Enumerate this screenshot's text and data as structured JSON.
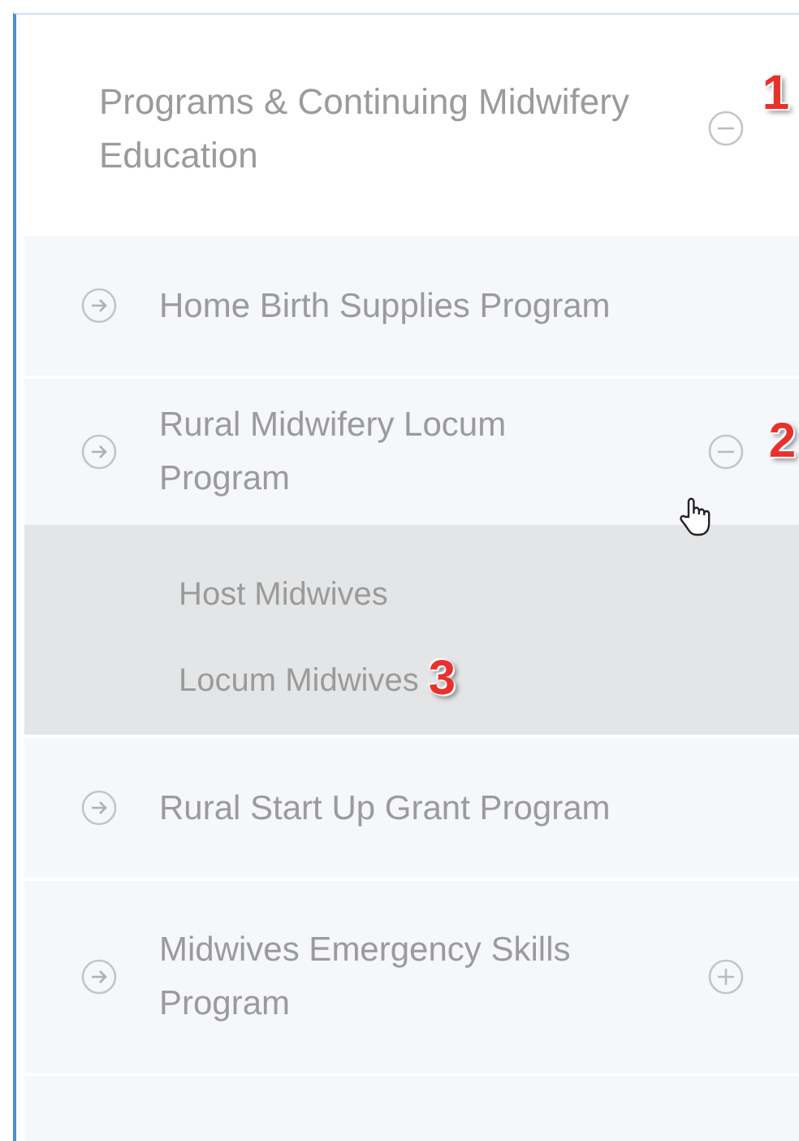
{
  "menu": {
    "header": {
      "label": "Programs & Continuing Midwifery Education",
      "expanded": true,
      "callout": "1"
    },
    "items": [
      {
        "label": "Home Birth Supplies Program"
      },
      {
        "label": "Rural Midwifery Locum Program",
        "expanded": true,
        "callout": "2",
        "children": [
          {
            "label": "Host Midwives"
          },
          {
            "label": "Locum Midwives",
            "callout": "3"
          }
        ]
      },
      {
        "label": "Rural Start Up Grant Program"
      },
      {
        "label": "Midwives Emergency Skills Program",
        "expanded": false
      }
    ]
  }
}
